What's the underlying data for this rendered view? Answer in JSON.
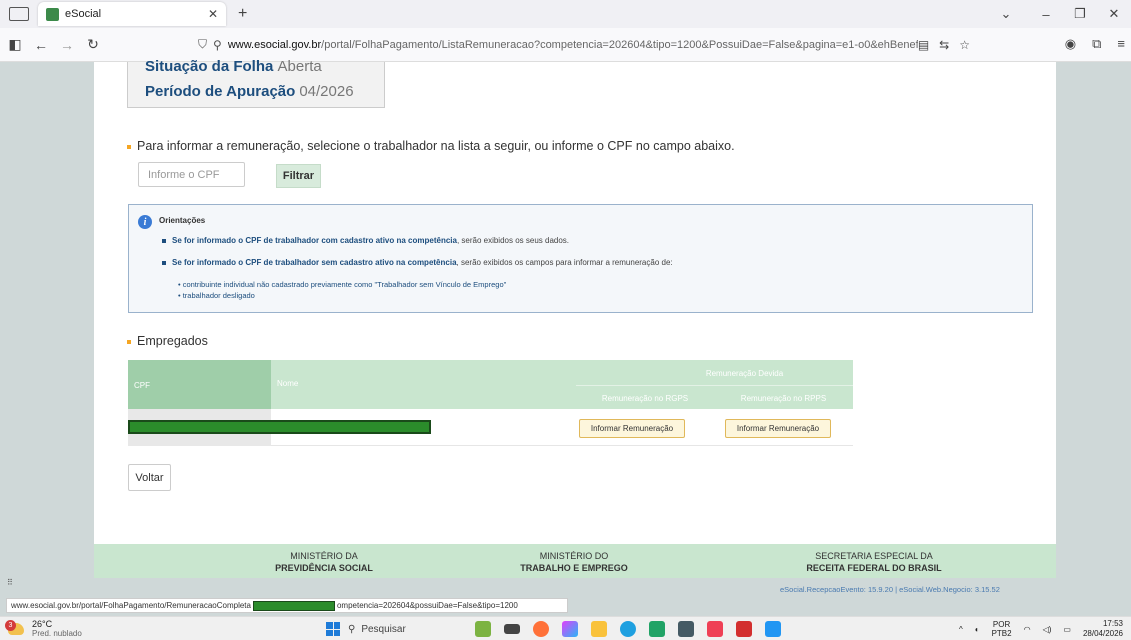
{
  "browser": {
    "tab_title": "eSocial",
    "url_host": "www.esocial.gov.br",
    "url_path": "/portal/FolhaPagamento/ListaRemuneracao?competencia=202604&tipo=1200&PossuiDae=False&pagina=e1-o0&ehBeneficia"
  },
  "header": {
    "situacao_label": "Situação da Folha",
    "situacao_value": "Aberta",
    "periodo_label": "Período de Apuração",
    "periodo_value": "04/2026"
  },
  "search": {
    "instruction": "Para informar a remuneração, selecione o trabalhador na lista a seguir, ou informe o CPF no campo abaixo.",
    "placeholder": "Informe o CPF",
    "filter_label": "Filtrar"
  },
  "orientacoes": {
    "title": "Orientações",
    "item1_bold": "Se for informado o CPF de trabalhador com cadastro ativo na competência",
    "item1_rest": ", serão exibidos os seus dados.",
    "item2_bold": "Se for informado o CPF de trabalhador sem cadastro ativo na competência",
    "item2_rest": ", serão exibidos os campos para informar a remuneração de:",
    "sub1": "• contribuinte individual não cadastrado previamente como \"Trabalhador sem Vínculo de Emprego\"",
    "sub2": "• trabalhador desligado"
  },
  "empregados": {
    "title": "Empregados",
    "col_cpf": "CPF",
    "col_nome": "Nome",
    "col_rem": "Remuneração Devida",
    "col_rgps": "Remuneração no RGPS",
    "col_rpps": "Remuneração no RPPS",
    "btn_rgps": "Informar Remuneração",
    "btn_rpps": "Informar Remuneração"
  },
  "voltar_label": "Voltar",
  "footer": {
    "m1_line1": "MINISTÉRIO DA",
    "m1_line2": "PREVIDÊNCIA SOCIAL",
    "m2_line1": "MINISTÉRIO DO",
    "m2_line2": "TRABALHO E EMPREGO",
    "m3_line1": "SECRETARIA ESPECIAL DA",
    "m3_line2": "RECEITA FEDERAL DO BRASIL",
    "version": "eSocial.RecepcaoEvento: 15.9.20 | eSocial.Web.Negocio: 3.15.52"
  },
  "status": {
    "link_before": "www.esocial.gov.br/portal/FolhaPagamento/RemuneracaoCompleta",
    "link_after": "ompetencia=202604&possuiDae=False&tipo=1200"
  },
  "taskbar": {
    "weather_badge": "3",
    "temp": "26°C",
    "weather_desc": "Pred. nublado",
    "search_label": "Pesquisar",
    "lang1": "POR",
    "lang2": "PTB2",
    "time": "17:53",
    "date": "28/04/2026"
  }
}
